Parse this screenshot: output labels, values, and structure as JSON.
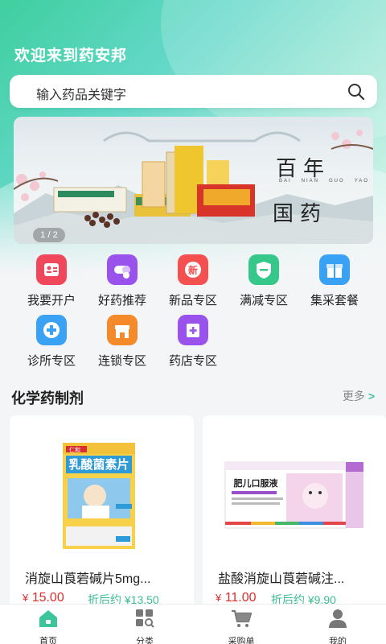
{
  "header": {
    "welcome": "欢迎来到药安邦"
  },
  "search": {
    "placeholder": "输入药品关键字"
  },
  "banner": {
    "indicator": "1 / 2",
    "title_line1": "百年",
    "title_line2": "国药",
    "subtitle": [
      "BAI",
      "NIAN",
      "GUO",
      "YAO"
    ]
  },
  "quick_menu": [
    {
      "label": "我要开户",
      "icon": "user-card-icon",
      "color": "#f0485a"
    },
    {
      "label": "好药推荐",
      "icon": "pill-icon",
      "color": "#9a52ec"
    },
    {
      "label": "新品专区",
      "icon": "new-badge-icon",
      "color": "#f45050"
    },
    {
      "label": "满减专区",
      "icon": "shield-discount-icon",
      "color": "#35c88a"
    },
    {
      "label": "集采套餐",
      "icon": "gift-icon",
      "color": "#3aa2f4"
    },
    {
      "label": "诊所专区",
      "icon": "clinic-cross-icon",
      "color": "#3aa2f4"
    },
    {
      "label": "连锁专区",
      "icon": "store-icon",
      "color": "#f58a2a"
    },
    {
      "label": "药店专区",
      "icon": "pharmacy-icon",
      "color": "#9a52ec"
    }
  ],
  "section": {
    "title": "化学药制剂",
    "more": "更多"
  },
  "products": [
    {
      "name": "消旋山莨菪碱片5mg...",
      "currency": "¥",
      "price": "15.00",
      "discount_label": "折后约 ¥13.50",
      "box_text": "乳酸菌素片",
      "brand": "仁和"
    },
    {
      "name": "盐酸消旋山莨菪碱注...",
      "currency": "¥",
      "price": "11.00",
      "discount_label": "折后约 ¥9.90",
      "box_text": "肥儿口服液"
    }
  ],
  "tabbar": [
    {
      "label": "首页",
      "icon": "home-icon",
      "active": true
    },
    {
      "label": "分类",
      "icon": "category-icon",
      "active": false
    },
    {
      "label": "采购单",
      "icon": "cart-icon",
      "active": false
    },
    {
      "label": "我的",
      "icon": "profile-icon",
      "active": false
    }
  ],
  "colors": {
    "accent": "#3cc49a",
    "price": "#e02d2d",
    "discount": "#3cbc93"
  }
}
